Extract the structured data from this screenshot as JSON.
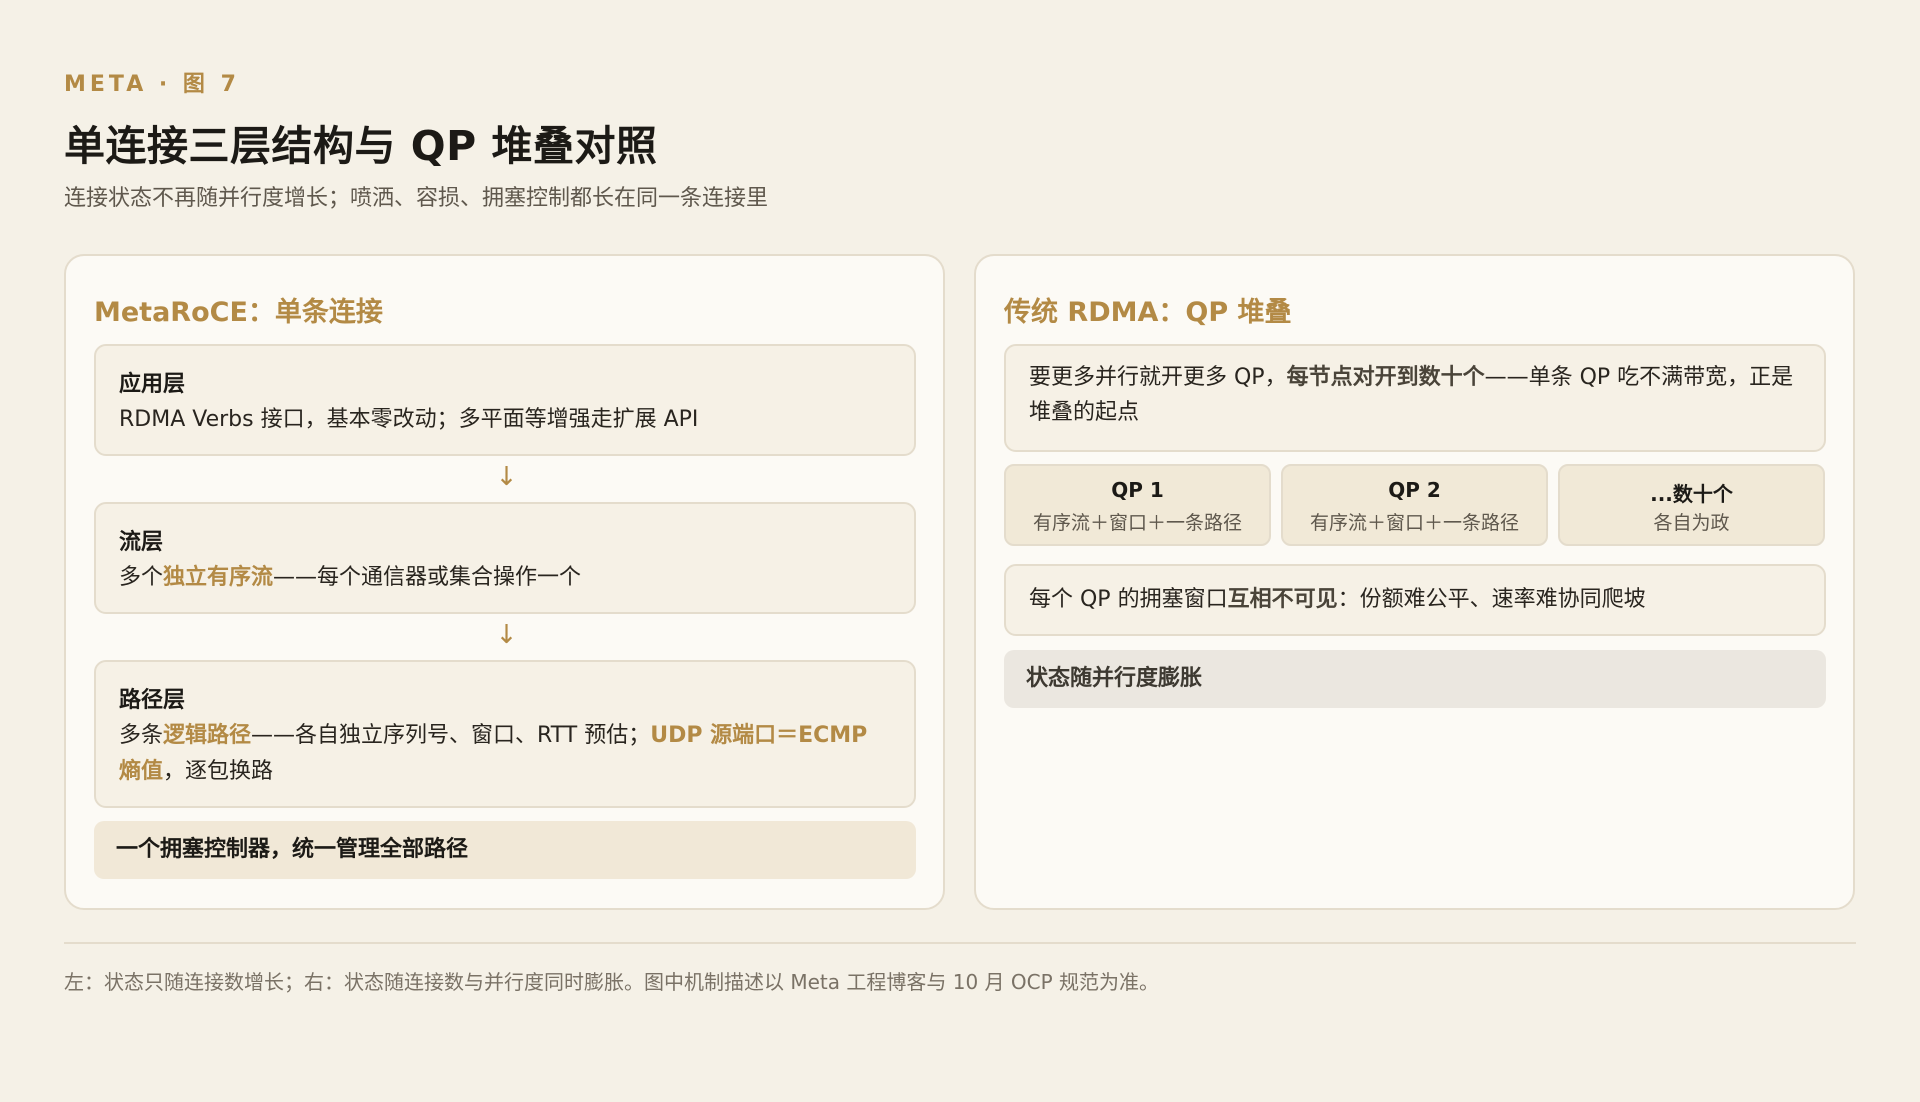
{
  "header": {
    "eyebrow": "META · 图 7",
    "title": "单连接三层结构与 QP 堆叠对照",
    "subtitle": "连接状态不再随并行度增长；喷洒、容损、拥塞控制都长在同一条连接里"
  },
  "left_panel": {
    "title": "MetaRoCE：单条连接",
    "layers": [
      {
        "label": "应用层",
        "desc": "RDMA Verbs 接口，基本零改动；多平面等增强走扩展 API"
      },
      {
        "label": "流层",
        "desc_pre": "多个",
        "desc_hl": "独立有序流",
        "desc_post": "——每个通信器或集合操作一个"
      },
      {
        "label": "路径层",
        "desc_pre": "多条",
        "desc_hl": "逻辑路径",
        "desc_mid": "——各自独立序列号、窗口、RTT 预估；",
        "desc_hl2": "UDP 源端口＝ECMP 熵值",
        "desc_post": "，逐包换路"
      }
    ],
    "arrow": "↓",
    "banner": "一个拥塞控制器，统一管理全部路径"
  },
  "right_panel": {
    "title": "传统 RDMA：QP 堆叠",
    "intro_pre": "要更多并行就开更多 QP，",
    "intro_bold": "每节点对开到数十个",
    "intro_post": "——单条 QP 吃不满带宽，正是堆叠的起点",
    "qps": [
      {
        "name": "QP 1",
        "desc": "有序流＋窗口＋一条路径"
      },
      {
        "name": "QP 2",
        "desc": "有序流＋窗口＋一条路径"
      },
      {
        "name": "...数十个",
        "desc": "各自为政"
      }
    ],
    "note_pre": "每个 QP 的拥塞窗口",
    "note_bold": "互相不可见",
    "note_post": "：份额难公平、速率难协同爬坡",
    "banner": "状态随并行度膨胀"
  },
  "footer": {
    "caption": "左：状态只随连接数增长；右：状态随连接数与并行度同时膨胀。图中机制描述以 Meta 工程博客与 10 月 OCP 规范为准。"
  },
  "colors": {
    "accent": "#b38a45",
    "background": "#f5f1e7",
    "panel": "#fcfaf5",
    "box": "#f6f1e6",
    "border": "#e4dccc"
  }
}
